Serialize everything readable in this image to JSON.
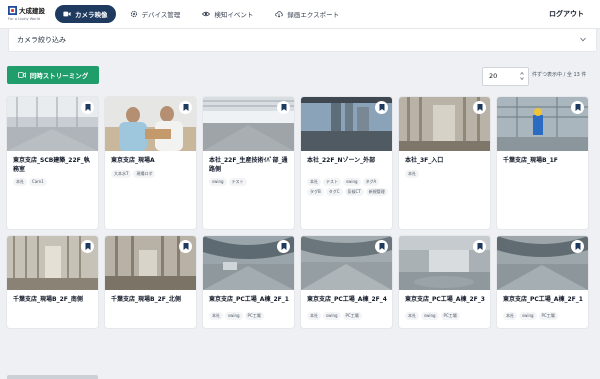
{
  "brand": {
    "name": "大成建設",
    "tagline": "For a Lively World"
  },
  "nav": [
    {
      "label": "カメラ映像",
      "icon": "video-icon",
      "active": true
    },
    {
      "label": "デバイス管理",
      "icon": "gear-icon",
      "active": false
    },
    {
      "label": "検知イベント",
      "icon": "eye-icon",
      "active": false
    },
    {
      "label": "録画エクスポート",
      "icon": "cloud-download-icon",
      "active": false
    }
  ],
  "logout": "ログアウト",
  "filter": {
    "label": "カメラ絞り込み"
  },
  "toolbar": {
    "stream_button": "同時ストリーミング",
    "per_page_value": "20",
    "per_page_text": "件ずつ表示中 / 全 13 件"
  },
  "cards": [
    {
      "title": "東京支店_SCB建築_22F_執務室",
      "tags": [
        "本社",
        "Cam1"
      ]
    },
    {
      "title": "東京支店_現場A",
      "tags": [
        "大本水T",
        "現場ロボ"
      ]
    },
    {
      "title": "本社_22F_生産技術ｲﾊﾞ部_通路側",
      "tags": [
        "swing",
        "テスト"
      ]
    },
    {
      "title": "本社_22F_Nゾーン_外部",
      "tags": [
        "本社",
        "テスト",
        "swing",
        "タグA",
        "タグB",
        "タグC",
        "気候CT",
        "新規管理"
      ]
    },
    {
      "title": "本社_3F_入口",
      "tags": [
        "本社"
      ]
    },
    {
      "title": "千葉支店_現場B_1F",
      "tags": []
    },
    {
      "title": "千葉支店_現場B_2F_南側",
      "tags": []
    },
    {
      "title": "千葉支店_現場B_2F_北側",
      "tags": []
    },
    {
      "title": "東京支店_PC工場_A棟_2F_1",
      "tags": [
        "本社",
        "swing",
        "PC工場"
      ]
    },
    {
      "title": "東京支店_PC工場_A棟_2F_4",
      "tags": [
        "本社",
        "swing",
        "PC工場"
      ]
    },
    {
      "title": "東京支店_PC工場_A棟_2F_3",
      "tags": [
        "本社",
        "swing",
        "PC工場"
      ]
    },
    {
      "title": "東京支店_PC工場_A棟_2F_1",
      "tags": [
        "本社",
        "swing",
        "PC工場"
      ]
    }
  ],
  "colors": {
    "nav_active": "#1e3a5f",
    "stream_button": "#1f9d6b",
    "bookmark": "#1e3a5f",
    "background": "#eef0f3"
  }
}
